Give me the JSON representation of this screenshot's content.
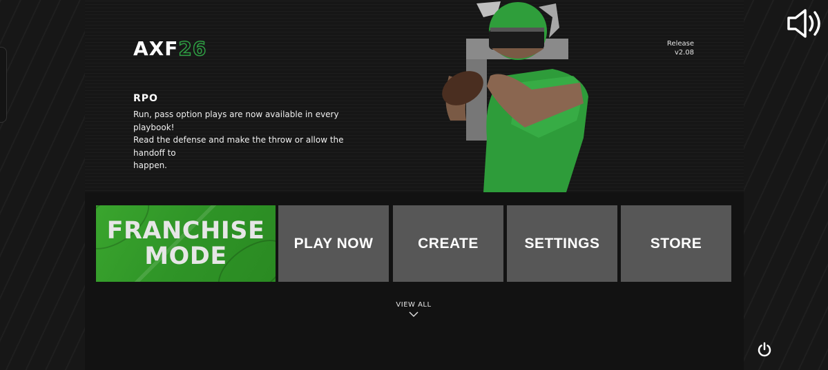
{
  "logo": {
    "white": "AXF",
    "green": "26"
  },
  "release": {
    "line1": "Release",
    "line2": "v2.08"
  },
  "news": {
    "title": "RPO",
    "body_lines": [
      "Run, pass option plays are now available in every playbook!",
      "Read the defense and make the throw or allow the handoff to",
      "happen."
    ]
  },
  "menu": {
    "franchise_line1": "FRANCHISE",
    "franchise_line2": "MODE",
    "play_now": "PLAY NOW",
    "create": "CREATE",
    "settings": "SETTINGS",
    "store": "STORE"
  },
  "view_all": "VIEW ALL",
  "icons": {
    "sound": "speaker-volume-icon",
    "power": "power-icon",
    "view_all": "chevron-down-icon"
  },
  "colors": {
    "accent_green": "#2ea043",
    "tile_gray": "#575757",
    "franchise_green": "#35a02b"
  }
}
